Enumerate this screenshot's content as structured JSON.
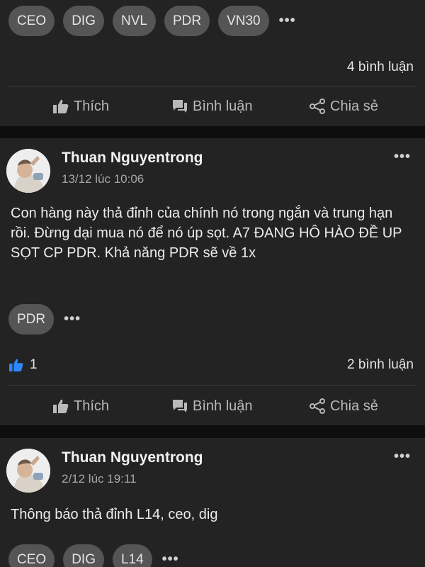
{
  "post0": {
    "tags": [
      "CEO",
      "DIG",
      "NVL",
      "PDR",
      "VN30"
    ],
    "more": "•••",
    "comments": "4 bình luận",
    "actions": {
      "like": "Thích",
      "comment": "Bình luận",
      "share": "Chia sẻ"
    }
  },
  "post1": {
    "author": "Thuan Nguyentrong",
    "time": "13/12 lúc 10:06",
    "more": "•••",
    "text": "Con hàng này thả đỉnh của chính nó trong ngắn và trung hạn rồi. Đừng dại mua nó để nó úp sọt. A7 ĐANG HÔ HÀO ĐỀ UP SỌT CP PDR. Khả năng PDR sẽ về 1x",
    "tags": [
      "PDR"
    ],
    "tags_more": "•••",
    "likes": "1",
    "comments": "2 bình luận",
    "actions": {
      "like": "Thích",
      "comment": "Bình luận",
      "share": "Chia sẻ"
    }
  },
  "post2": {
    "author": "Thuan Nguyentrong",
    "time": "2/12 lúc 19:11",
    "more": "•••",
    "text": "Thông báo thả đỉnh L14, ceo, dig",
    "tags": [
      "CEO",
      "DIG",
      "L14"
    ],
    "tags_more": "•••"
  },
  "colors": {
    "card_bg": "#232323",
    "page_bg": "#0e0e0e",
    "tag_bg": "#555555",
    "like_blue": "#2d88ff"
  },
  "icons": {
    "like": "thumbs-up-icon",
    "comment": "speech-bubble-icon",
    "share": "share-icon",
    "liked": "blue-thumbs-up-icon"
  }
}
